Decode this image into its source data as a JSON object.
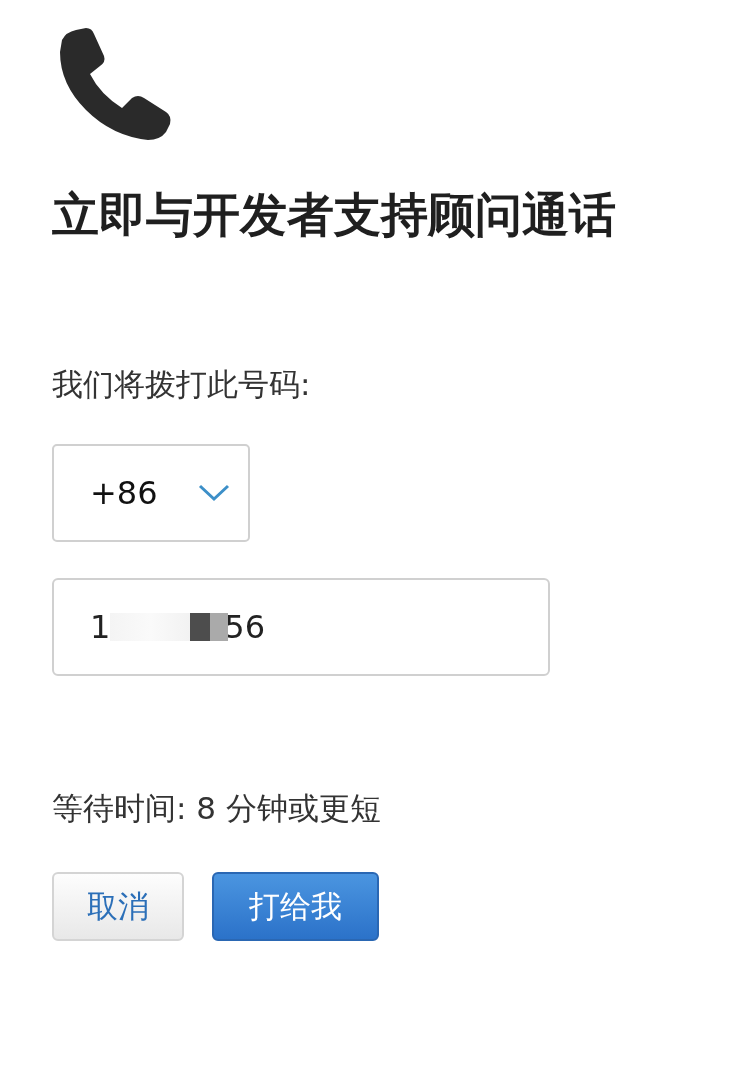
{
  "title": "立即与开发者支持顾问通话",
  "number_label": "我们将拨打此号码:",
  "country_code": {
    "value": "+86"
  },
  "phone": {
    "visible_start": "1",
    "redacted": true,
    "visible_end": "56"
  },
  "wait_time": "等待时间: 8 分钟或更短",
  "buttons": [
    {
      "label": "取消",
      "kind": "secondary"
    },
    {
      "label": "打给我",
      "kind": "primary"
    }
  ]
}
